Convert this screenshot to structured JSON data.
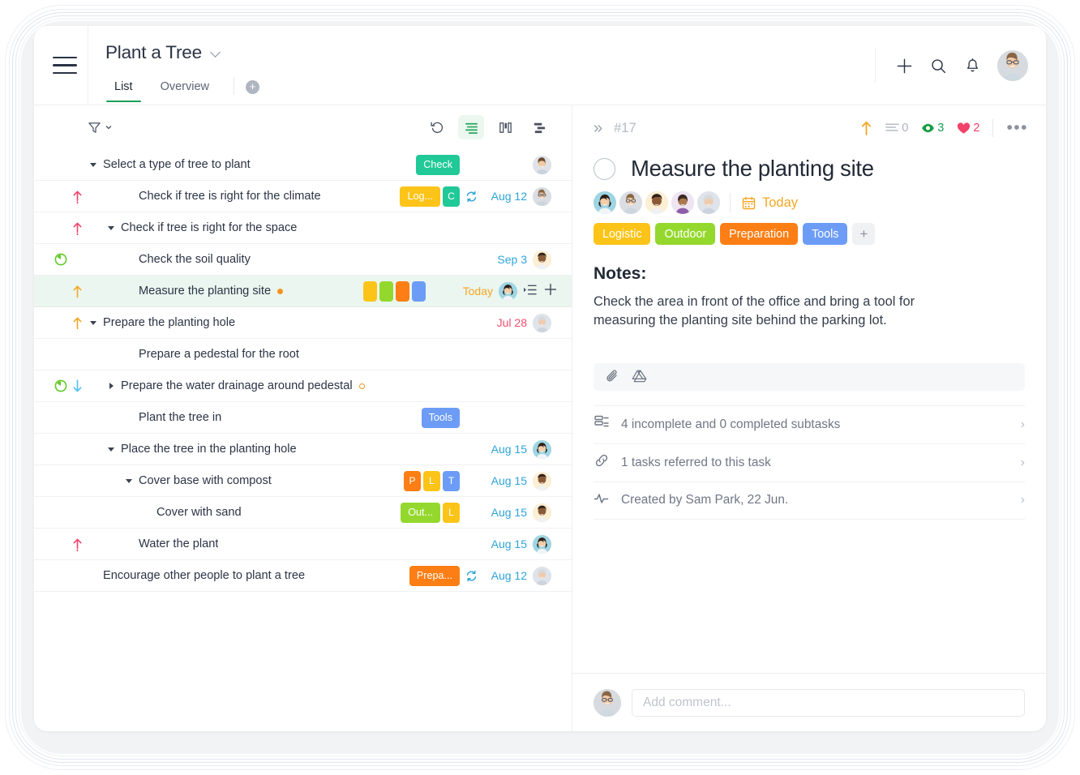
{
  "window": {
    "project_title": "Plant a Tree",
    "menu_icon": "hamburger-icon",
    "tabs": [
      {
        "label": "List",
        "active": true
      },
      {
        "label": "Overview",
        "active": false
      }
    ],
    "add_tab_label": "+",
    "header_actions": [
      {
        "name": "add-icon",
        "label": "+"
      },
      {
        "name": "search-icon",
        "label": ""
      },
      {
        "name": "notifications-icon",
        "label": ""
      },
      {
        "name": "user-avatar",
        "label": ""
      }
    ]
  },
  "list_toolbar": {
    "filter_label": "",
    "views": [
      {
        "name": "history-icon",
        "active": false
      },
      {
        "name": "list-view-icon",
        "active": true
      },
      {
        "name": "board-view-icon",
        "active": false
      },
      {
        "name": "timeline-view-icon",
        "active": false
      }
    ]
  },
  "tasks": [
    {
      "title": "Select a type of tree to plant",
      "indent": 0,
      "twisty": "expanded",
      "priority": "",
      "progress": false,
      "selected": false,
      "marker": "",
      "tags": [
        {
          "text": "Check",
          "color": "#20c997",
          "short": false
        }
      ],
      "recurring": false,
      "date": "",
      "date_color": "",
      "assignee": true,
      "assignee_type": 1
    },
    {
      "title": "Check if tree is right for the climate",
      "indent": 2,
      "twisty": "",
      "priority": "urgent",
      "progress": false,
      "selected": false,
      "marker": "",
      "tags": [
        {
          "text": "Log...",
          "color": "#fcc419",
          "short": false
        },
        {
          "text": "C",
          "color": "#20c997",
          "short": true
        }
      ],
      "recurring": true,
      "date": "Aug 12",
      "date_color": "blue",
      "assignee": true,
      "assignee_type": 2
    },
    {
      "title": "Check if tree is right for the space",
      "indent": 1,
      "twisty": "expanded",
      "priority": "urgent",
      "progress": false,
      "selected": false,
      "marker": "",
      "tags": [],
      "recurring": false,
      "date": "",
      "date_color": "",
      "assignee": false,
      "assignee_type": 0
    },
    {
      "title": "Check the soil quality",
      "indent": 2,
      "twisty": "",
      "priority": "",
      "progress": true,
      "selected": false,
      "marker": "",
      "tags": [],
      "recurring": false,
      "date": "Sep 3",
      "date_color": "blue",
      "assignee": true,
      "assignee_type": 3
    },
    {
      "title": "Measure the planting site",
      "indent": 2,
      "twisty": "",
      "priority": "high",
      "progress": false,
      "selected": true,
      "marker": "dot",
      "tags": [
        {
          "text": "",
          "color": "#fcc419",
          "short": true,
          "chip": true
        },
        {
          "text": "",
          "color": "#94d82d",
          "short": true,
          "chip": true
        },
        {
          "text": "",
          "color": "#fd7e14",
          "short": true,
          "chip": true
        },
        {
          "text": "",
          "color": "#6c9cf5",
          "short": true,
          "chip": true
        }
      ],
      "recurring": false,
      "date": "Today",
      "date_color": "orange",
      "assignee": true,
      "assignee_type": 4,
      "row_icons": [
        "add-subtask-icon",
        "add-icon"
      ]
    },
    {
      "title": "Prepare the planting hole",
      "indent": 0,
      "twisty": "expanded",
      "priority": "high",
      "progress": false,
      "selected": false,
      "marker": "",
      "tags": [],
      "recurring": false,
      "date": "Jul 28",
      "date_color": "red",
      "assignee": true,
      "assignee_type": 5
    },
    {
      "title": "Prepare a pedestal for the root",
      "indent": 2,
      "twisty": "",
      "priority": "",
      "progress": false,
      "selected": false,
      "marker": "",
      "tags": [],
      "recurring": false,
      "date": "",
      "date_color": "",
      "assignee": false,
      "assignee_type": 0
    },
    {
      "title": "Prepare the water drainage around pedestal",
      "indent": 1,
      "twisty": "collapsed",
      "priority": "low",
      "progress": true,
      "selected": false,
      "marker": "ring",
      "tags": [],
      "recurring": false,
      "date": "",
      "date_color": "",
      "assignee": false,
      "assignee_type": 0
    },
    {
      "title": "Plant the tree in",
      "indent": 2,
      "twisty": "",
      "priority": "",
      "progress": false,
      "selected": false,
      "marker": "",
      "tags": [
        {
          "text": "Tools",
          "color": "#6c9cf5",
          "short": false
        }
      ],
      "recurring": false,
      "date": "",
      "date_color": "",
      "assignee": false,
      "assignee_type": 0
    },
    {
      "title": "Place the tree in the planting hole",
      "indent": 1,
      "twisty": "expanded",
      "priority": "",
      "progress": false,
      "selected": false,
      "marker": "",
      "tags": [],
      "recurring": false,
      "date": "Aug 15",
      "date_color": "blue",
      "assignee": true,
      "assignee_type": 4
    },
    {
      "title": "Cover base with compost",
      "indent": 2,
      "twisty": "expanded",
      "priority": "",
      "progress": false,
      "selected": false,
      "marker": "",
      "tags": [
        {
          "text": "P",
          "color": "#fd7e14",
          "short": true
        },
        {
          "text": "L",
          "color": "#fcc419",
          "short": true
        },
        {
          "text": "T",
          "color": "#6c9cf5",
          "short": true
        }
      ],
      "recurring": false,
      "date": "Aug 15",
      "date_color": "blue",
      "assignee": true,
      "assignee_type": 3
    },
    {
      "title": "Cover with sand",
      "indent": 3,
      "twisty": "",
      "priority": "",
      "progress": false,
      "selected": false,
      "marker": "",
      "tags": [
        {
          "text": "Out...",
          "color": "#94d82d",
          "short": false
        },
        {
          "text": "L",
          "color": "#fcc419",
          "short": true
        }
      ],
      "recurring": false,
      "date": "Aug 15",
      "date_color": "blue",
      "assignee": true,
      "assignee_type": 3
    },
    {
      "title": "Water the plant",
      "indent": 2,
      "twisty": "",
      "priority": "urgent",
      "progress": false,
      "selected": false,
      "marker": "",
      "tags": [],
      "recurring": false,
      "date": "Aug 15",
      "date_color": "blue",
      "assignee": true,
      "assignee_type": 4
    },
    {
      "title": "Encourage other people to plant a tree",
      "indent": 0,
      "twisty": "",
      "priority": "",
      "progress": false,
      "selected": false,
      "marker": "",
      "tags": [
        {
          "text": "Prepa...",
          "color": "#fd7e14",
          "short": false
        }
      ],
      "recurring": true,
      "date": "Aug 12",
      "date_color": "blue",
      "assignee": true,
      "assignee_type": 5
    }
  ],
  "detail": {
    "collapse_icon": "»",
    "task_id": "#17",
    "priority_icon": "priority-high-arrow",
    "meta": [
      {
        "name": "description-count",
        "value": "0"
      },
      {
        "name": "watchers-count",
        "value": "3"
      },
      {
        "name": "likes-count",
        "value": "2"
      }
    ],
    "more_label": "•••",
    "title": "Measure the planting site",
    "date_label": "Today",
    "tags": [
      {
        "label": "Logistic",
        "color": "#fcc419"
      },
      {
        "label": "Outdoor",
        "color": "#94d82d"
      },
      {
        "label": "Preparation",
        "color": "#fd7e14"
      },
      {
        "label": "Tools",
        "color": "#6c9cf5"
      }
    ],
    "add_tag_label": "+",
    "notes_heading": "Notes:",
    "notes_body": "Check the area in front of the office and bring a tool for measuring the planting site behind the parking lot.",
    "attachment_icons": [
      "paperclip-icon",
      "google-drive-icon"
    ],
    "meta_rows": [
      {
        "icon": "subtasks-icon",
        "label": "4 incomplete and 0 completed subtasks",
        "arrow": "›"
      },
      {
        "icon": "link-icon",
        "label": "1 tasks referred to this task",
        "arrow": "›"
      },
      {
        "icon": "activity-icon",
        "label": "Created by Sam Park, 22 Jun.",
        "arrow": "›"
      }
    ],
    "comment_placeholder": "Add comment..."
  },
  "colors": {
    "accent_green": "#1e9e5a",
    "selected_row": "#eaf6ef",
    "date_blue": "#2ea4d8",
    "date_orange": "#f5a623",
    "date_red": "#ef4f6e",
    "priority_urgent": "#f2426a",
    "priority_high": "#f5a623",
    "priority_low": "#4fc0f0"
  }
}
